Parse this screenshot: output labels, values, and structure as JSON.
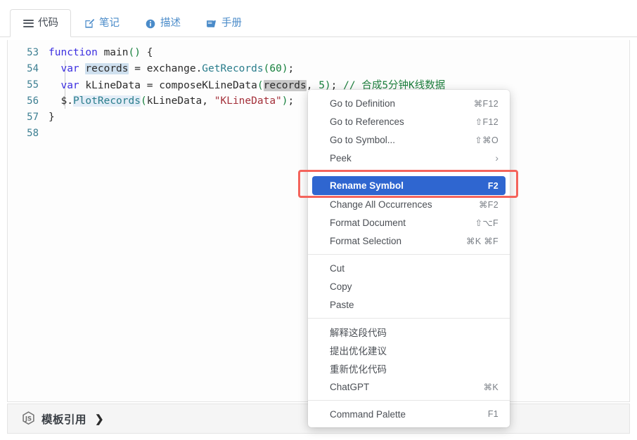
{
  "tabs": [
    {
      "label": "代码",
      "icon": "list-icon",
      "active": true
    },
    {
      "label": "笔记",
      "icon": "edit-icon",
      "active": false
    },
    {
      "label": "描述",
      "icon": "info-icon",
      "active": false
    },
    {
      "label": "手册",
      "icon": "book-icon",
      "active": false
    }
  ],
  "editor": {
    "lines": [
      {
        "no": "53",
        "text": "function main() {"
      },
      {
        "no": "54",
        "text": "  var records = exchange.GetRecords(60);"
      },
      {
        "no": "55",
        "text": "  var kLineData = composeKLineData(records, 5); // 合成5分钟K线数据"
      },
      {
        "no": "56",
        "text": "  $.PlotRecords(kLineData, \"KLineData\");"
      },
      {
        "no": "57",
        "text": "}"
      },
      {
        "no": "58",
        "text": ""
      }
    ],
    "tokens": {
      "fn_keyword": "function",
      "fn_name": "main",
      "var_keyword": "var",
      "records": "records",
      "exchange": "exchange",
      "getrecords": "GetRecords",
      "num60": "60",
      "klinedata_var": "kLineData",
      "composefn": "composeKLineData",
      "num5": "5",
      "comment": "// 合成5分钟K线数据",
      "dollar": "$",
      "plotrecords": "PlotRecords",
      "string_klinedata": "\"KLineData\""
    },
    "colors": {
      "keyword": "#3b2ee0",
      "function": "#2a7d8c",
      "number": "#17803d",
      "string": "#a4303a",
      "comment": "#1d7f3d",
      "line_number": "#3d7f92",
      "selection": "#cfe0ef",
      "occurrence": "#c8c8c8"
    }
  },
  "context_menu": {
    "groups": [
      {
        "items": [
          {
            "label": "Go to Definition",
            "shortcut": "⌘F12",
            "submenu": false,
            "highlight": false
          },
          {
            "label": "Go to References",
            "shortcut": "⇧F12",
            "submenu": false,
            "highlight": false
          },
          {
            "label": "Go to Symbol...",
            "shortcut": "⇧⌘O",
            "submenu": false,
            "highlight": false
          },
          {
            "label": "Peek",
            "shortcut": "",
            "submenu": true,
            "highlight": false
          }
        ]
      },
      {
        "items": [
          {
            "label": "Rename Symbol",
            "shortcut": "F2",
            "submenu": false,
            "highlight": true
          },
          {
            "label": "Change All Occurrences",
            "shortcut": "⌘F2",
            "submenu": false,
            "highlight": false
          },
          {
            "label": "Format Document",
            "shortcut": "⇧⌥F",
            "submenu": false,
            "highlight": false
          },
          {
            "label": "Format Selection",
            "shortcut": "⌘K ⌘F",
            "submenu": false,
            "highlight": false
          }
        ]
      },
      {
        "items": [
          {
            "label": "Cut",
            "shortcut": "",
            "submenu": false,
            "highlight": false
          },
          {
            "label": "Copy",
            "shortcut": "",
            "submenu": false,
            "highlight": false
          },
          {
            "label": "Paste",
            "shortcut": "",
            "submenu": false,
            "highlight": false
          }
        ]
      },
      {
        "items": [
          {
            "label": "解释这段代码",
            "shortcut": "",
            "submenu": false,
            "highlight": false,
            "cn": true
          },
          {
            "label": "提出优化建议",
            "shortcut": "",
            "submenu": false,
            "highlight": false,
            "cn": true
          },
          {
            "label": "重新优化代码",
            "shortcut": "",
            "submenu": false,
            "highlight": false,
            "cn": true
          },
          {
            "label": "ChatGPT",
            "shortcut": "⌘K",
            "submenu": false,
            "highlight": false
          }
        ]
      },
      {
        "items": [
          {
            "label": "Command Palette",
            "shortcut": "F1",
            "submenu": false,
            "highlight": false
          }
        ]
      }
    ],
    "highlight_color": "#2f66d0",
    "annotation_color": "#f4645c"
  },
  "bottom_bar": {
    "icon": "js-badge-icon",
    "label": "模板引用",
    "chevron": "❯"
  }
}
